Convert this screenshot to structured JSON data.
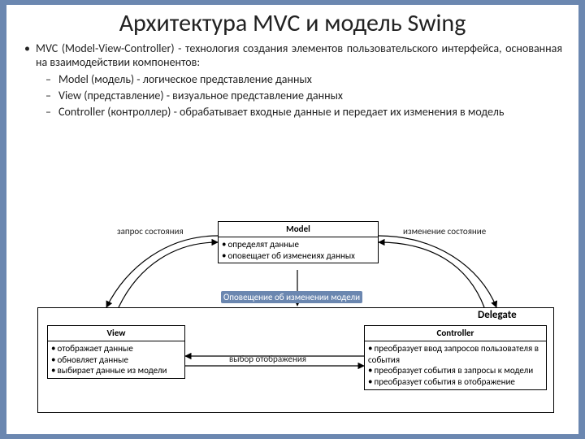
{
  "title": "Архитектура MVC и модель Swing",
  "intro": "MVC (Model-View-Controller) - технология создания элементов пользовательского интерфейса, основанная на взаимодействии компонентов:",
  "items": [
    "Model (модель) - логическое представление данных",
    "View (представление) - визуальное представление данных",
    "Controller (контроллер) - обрабатывает входные данные и передает их изменения в модель"
  ],
  "diagram": {
    "delegate_label": "Delegate",
    "model": {
      "title": "Model",
      "lines": [
        "определят данные",
        "оповещает об изменеиях данных"
      ]
    },
    "view": {
      "title": "View",
      "lines": [
        "отображает данные",
        "обновляет данные",
        "выбирает данные из модели"
      ]
    },
    "controller": {
      "title": "Controller",
      "lines": [
        "преобразует ввод запросов пользователя в события",
        "преобразует события в запросы к модели",
        "преобразует события в отображение"
      ]
    },
    "edges": {
      "state_request": "запрос состояния",
      "state_change": "изменение состояние",
      "model_notify": "Оповещение об изменении модели",
      "view_select": "выбор отображения"
    }
  }
}
